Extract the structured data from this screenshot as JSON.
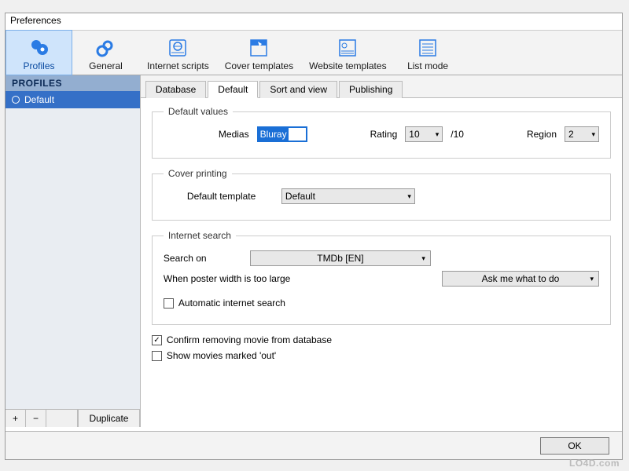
{
  "window": {
    "title": "Preferences"
  },
  "toolbar": {
    "items": [
      {
        "label": "Profiles"
      },
      {
        "label": "General"
      },
      {
        "label": "Internet scripts"
      },
      {
        "label": "Cover templates"
      },
      {
        "label": "Website templates"
      },
      {
        "label": "List mode"
      }
    ]
  },
  "sidebar": {
    "header": "PROFILES",
    "items": [
      {
        "label": "Default"
      }
    ],
    "buttons": {
      "add": "+",
      "remove": "−",
      "duplicate": "Duplicate"
    }
  },
  "tabs": {
    "items": [
      {
        "label": "Database"
      },
      {
        "label": "Default"
      },
      {
        "label": "Sort and view"
      },
      {
        "label": "Publishing"
      }
    ]
  },
  "default_values": {
    "legend": "Default values",
    "medias_label": "Medias",
    "medias_value": "Bluray",
    "rating_label": "Rating",
    "rating_value": "10",
    "rating_suffix": "/10",
    "region_label": "Region",
    "region_value": "2"
  },
  "cover_printing": {
    "legend": "Cover printing",
    "template_label": "Default template",
    "template_value": "Default"
  },
  "internet_search": {
    "legend": "Internet search",
    "search_on_label": "Search on",
    "search_on_value": "TMDb [EN]",
    "poster_width_label": "When poster width is too large",
    "poster_width_value": "Ask me what to do",
    "auto_search_label": "Automatic internet search"
  },
  "misc": {
    "confirm_remove_label": "Confirm removing movie from database",
    "show_out_label": "Show movies marked 'out'"
  },
  "footer": {
    "ok": "OK"
  },
  "watermark": "LO4D.com"
}
